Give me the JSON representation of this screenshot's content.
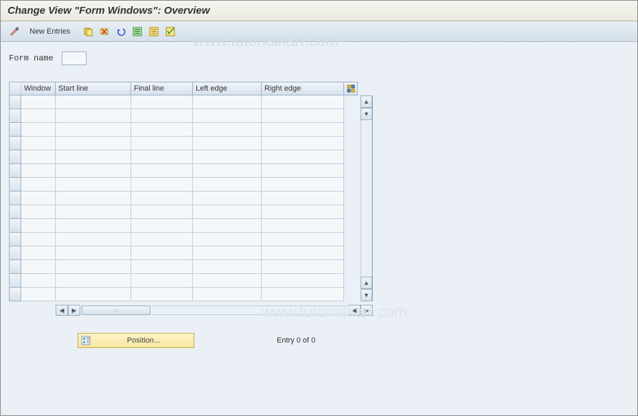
{
  "title": "Change View \"Form Windows\": Overview",
  "toolbar": {
    "new_entries": "New Entries"
  },
  "form": {
    "form_name_label": "Form name",
    "form_name_value": ""
  },
  "table": {
    "columns": {
      "window": "Window",
      "start_line": "Start line",
      "final_line": "Final line",
      "left_edge": "Left edge",
      "right_edge": "Right edge"
    },
    "rows": [
      {
        "window": "",
        "start_line": "",
        "final_line": "",
        "left_edge": "",
        "right_edge": ""
      },
      {
        "window": "",
        "start_line": "",
        "final_line": "",
        "left_edge": "",
        "right_edge": ""
      },
      {
        "window": "",
        "start_line": "",
        "final_line": "",
        "left_edge": "",
        "right_edge": ""
      },
      {
        "window": "",
        "start_line": "",
        "final_line": "",
        "left_edge": "",
        "right_edge": ""
      },
      {
        "window": "",
        "start_line": "",
        "final_line": "",
        "left_edge": "",
        "right_edge": ""
      },
      {
        "window": "",
        "start_line": "",
        "final_line": "",
        "left_edge": "",
        "right_edge": ""
      },
      {
        "window": "",
        "start_line": "",
        "final_line": "",
        "left_edge": "",
        "right_edge": ""
      },
      {
        "window": "",
        "start_line": "",
        "final_line": "",
        "left_edge": "",
        "right_edge": ""
      },
      {
        "window": "",
        "start_line": "",
        "final_line": "",
        "left_edge": "",
        "right_edge": ""
      },
      {
        "window": "",
        "start_line": "",
        "final_line": "",
        "left_edge": "",
        "right_edge": ""
      },
      {
        "window": "",
        "start_line": "",
        "final_line": "",
        "left_edge": "",
        "right_edge": ""
      },
      {
        "window": "",
        "start_line": "",
        "final_line": "",
        "left_edge": "",
        "right_edge": ""
      },
      {
        "window": "",
        "start_line": "",
        "final_line": "",
        "left_edge": "",
        "right_edge": ""
      },
      {
        "window": "",
        "start_line": "",
        "final_line": "",
        "left_edge": "",
        "right_edge": ""
      },
      {
        "window": "",
        "start_line": "",
        "final_line": "",
        "left_edge": "",
        "right_edge": ""
      }
    ]
  },
  "footer": {
    "position_label": "Position...",
    "entry_status": "Entry 0 of 0"
  },
  "watermark": "www.tutorialkart.com"
}
